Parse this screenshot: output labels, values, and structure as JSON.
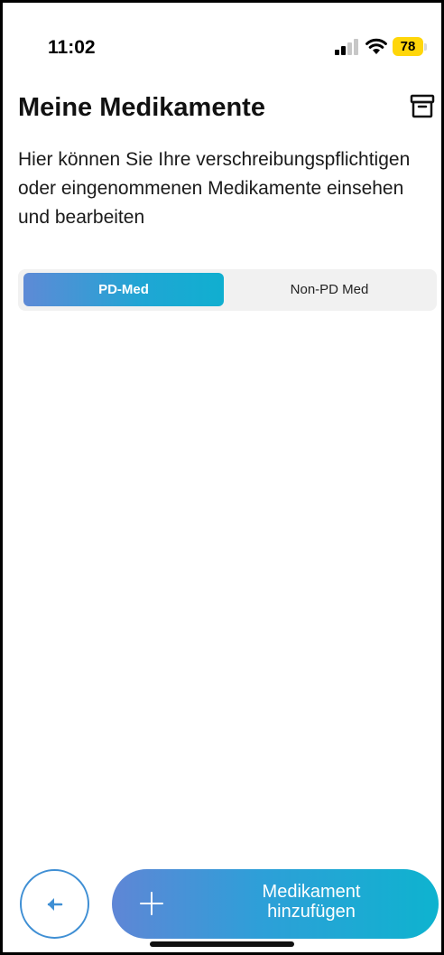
{
  "status_bar": {
    "time": "11:02",
    "battery_level": "78",
    "signal_icon": "cellular-signal-icon",
    "wifi_icon": "wifi-icon",
    "battery_color": "#ffd60a"
  },
  "header": {
    "title": "Meine Medikamente",
    "archive_icon": "archive-icon"
  },
  "description": "Hier können Sie Ihre verschreibungspflichtigen oder eingenommenen Medikamente einsehen und bearbeiten",
  "tabs": [
    {
      "label": "PD-Med",
      "selected": true
    },
    {
      "label": "Non-PD Med",
      "selected": false
    }
  ],
  "footer": {
    "back_icon": "arrow-left-icon",
    "add_icon": "plus-icon",
    "add_label_line1": "Medikament",
    "add_label_line2": "hinzufügen"
  },
  "colors": {
    "accent_start": "#5f86d6",
    "accent_end": "#0eb3cf",
    "back_border": "#3f8fd4"
  }
}
